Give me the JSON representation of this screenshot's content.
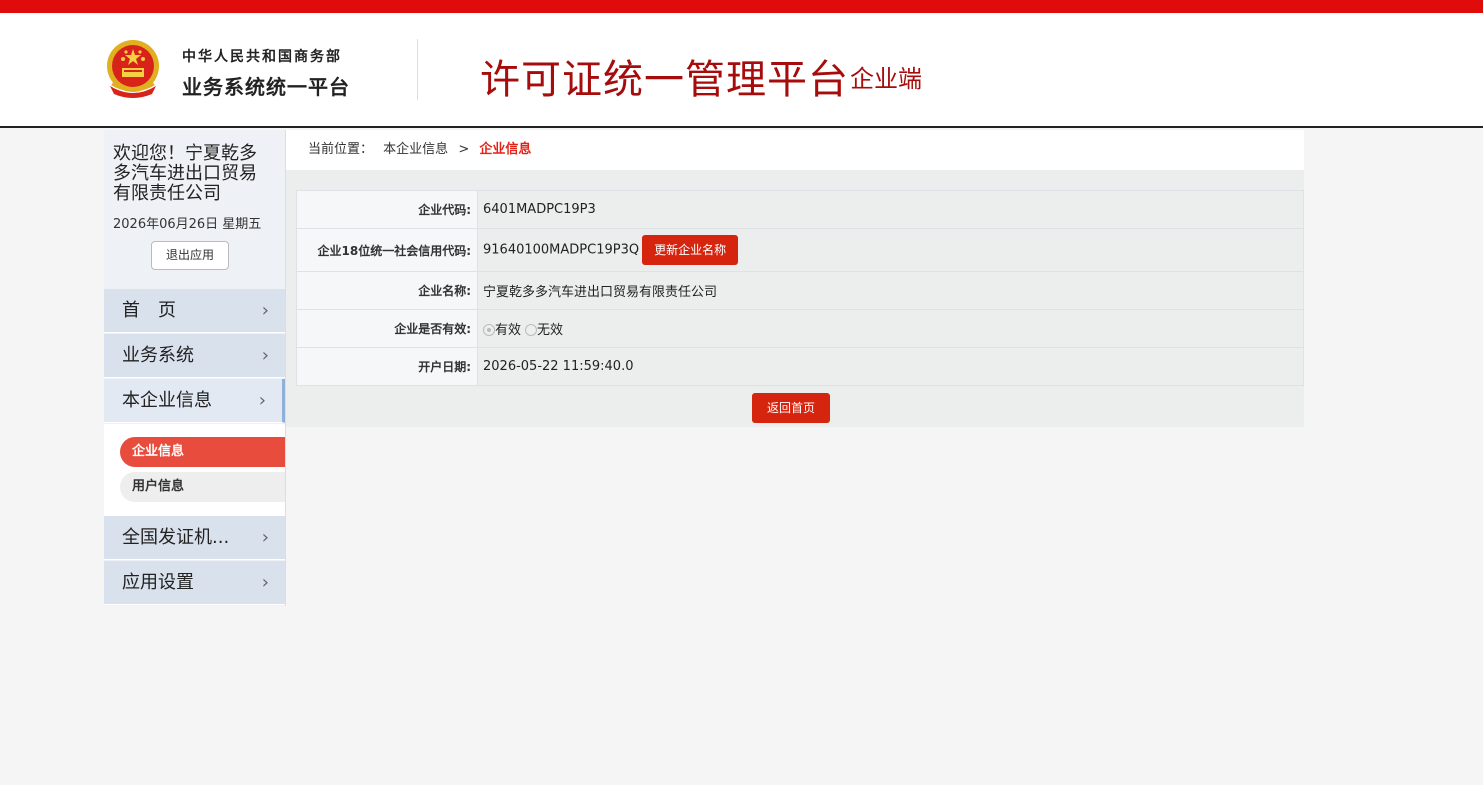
{
  "header": {
    "ministry": "中华人民共和国商务部",
    "system": "业务系统统一平台",
    "platform_title": "许可证统一管理平台",
    "platform_sub": "企业端"
  },
  "sidebar": {
    "welcome": "欢迎您！宁夏乾多多汽车进出口贸易有限责任公司",
    "date": "2026年06月26日 星期五",
    "logout": "退出应用",
    "nav": [
      {
        "label": "首　页"
      },
      {
        "label": "业务系统"
      },
      {
        "label": "本企业信息"
      },
      {
        "label": "全国发证机..."
      },
      {
        "label": "应用设置"
      }
    ],
    "sub": [
      {
        "label": "企业信息"
      },
      {
        "label": "用户信息"
      }
    ],
    "chevron": "›"
  },
  "breadcrumb": {
    "prefix": "当前位置：",
    "parent": "本企业信息",
    "sep": ">",
    "current": "企业信息"
  },
  "info": {
    "rows": [
      {
        "label": "企业代码:",
        "value": "6401MADPC19P3"
      },
      {
        "label": "企业18位统一社会信用代码:",
        "value": "91640100MADPC19P3Q"
      },
      {
        "label": "企业名称:",
        "value": "宁夏乾多多汽车进出口贸易有限责任公司"
      },
      {
        "label": "企业是否有效:",
        "value": ""
      },
      {
        "label": "开户日期:",
        "value": "2026-05-22 11:59:40.0"
      }
    ],
    "update_name_button": "更新企业名称",
    "valid_options": [
      "有效",
      "无效"
    ],
    "valid_selected": "有效"
  },
  "back_button": "返回首页",
  "colors": {
    "accent_red": "#d6250f",
    "title_red": "#a60c0c",
    "nav_bg": "#d9e1ed"
  }
}
